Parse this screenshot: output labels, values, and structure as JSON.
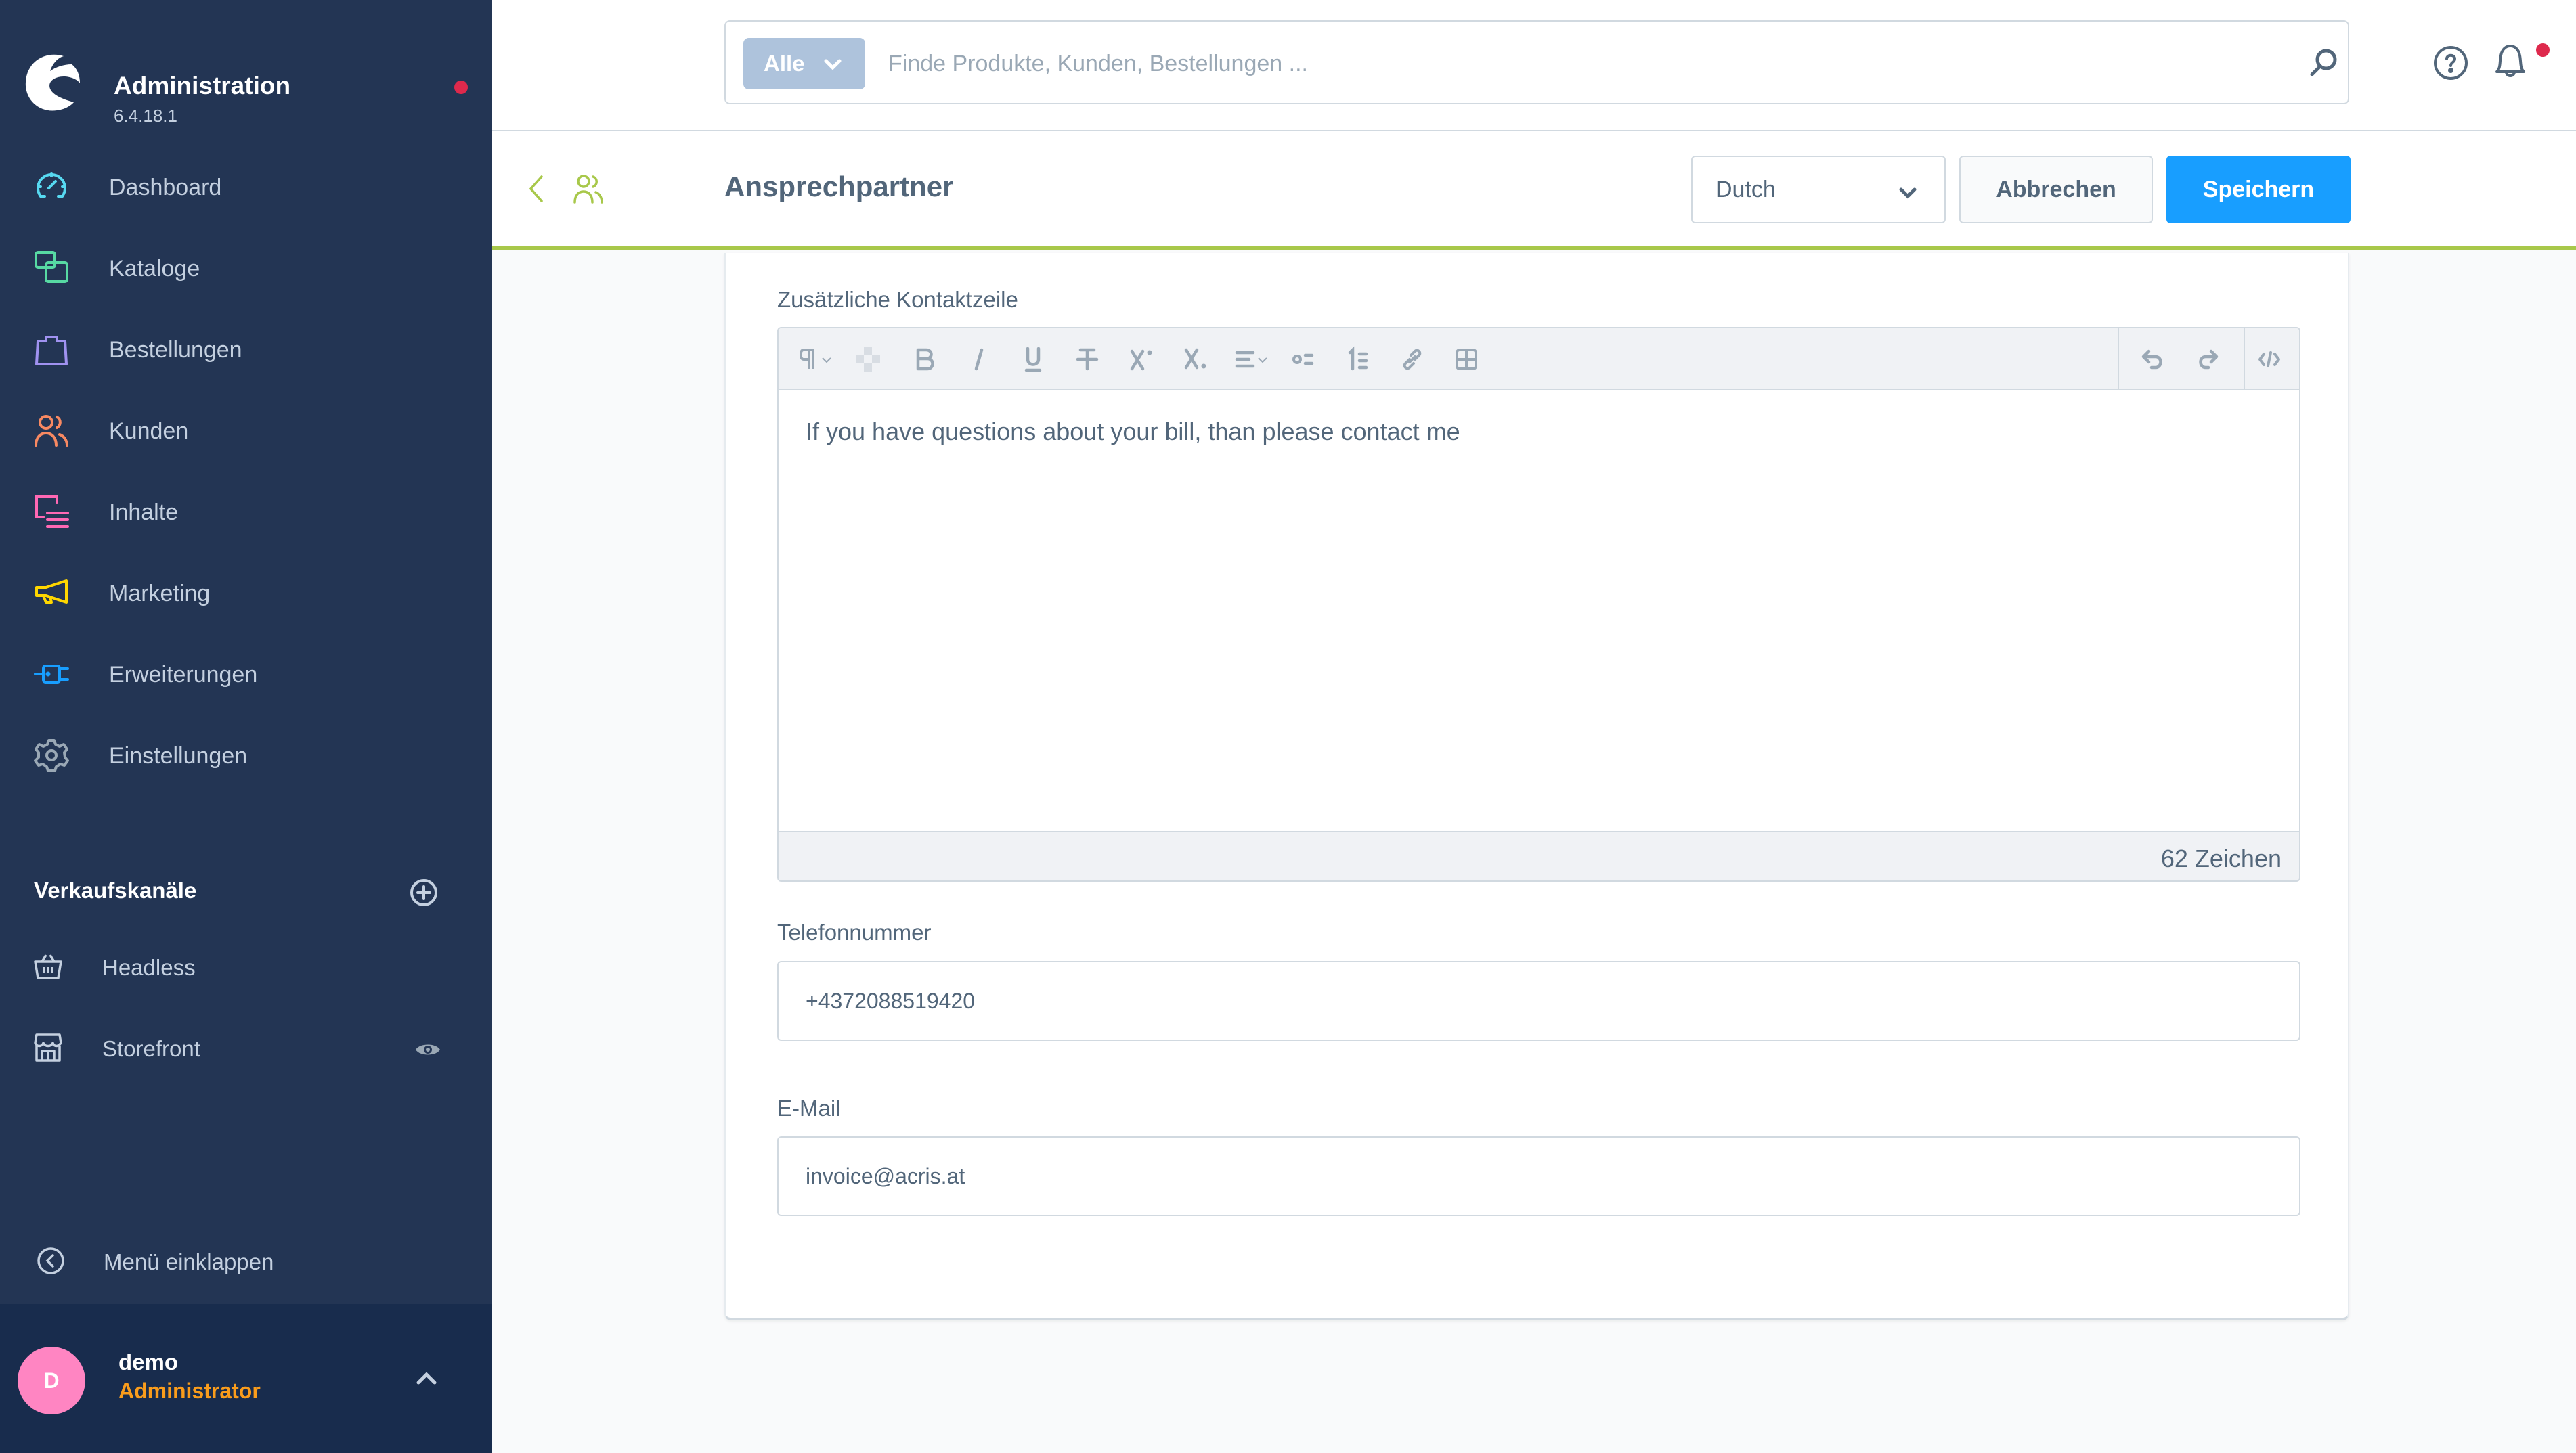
{
  "app": {
    "title": "Administration",
    "version": "6.4.18.1",
    "notification_dot_color": "#de294c"
  },
  "sidebar": {
    "items": [
      {
        "label": "Dashboard",
        "icon": "dashboard-icon",
        "color": "#57d9f1"
      },
      {
        "label": "Kataloge",
        "icon": "catalog-icon",
        "color": "#57d9a3"
      },
      {
        "label": "Bestellungen",
        "icon": "shopping-bag-icon",
        "color": "#a092f0"
      },
      {
        "label": "Kunden",
        "icon": "customers-icon",
        "color": "#f88962"
      },
      {
        "label": "Inhalte",
        "icon": "content-icon",
        "color": "#ff68b4"
      },
      {
        "label": "Marketing",
        "icon": "megaphone-icon",
        "color": "#ffd700"
      },
      {
        "label": "Erweiterungen",
        "icon": "plug-icon",
        "color": "#189eff"
      },
      {
        "label": "Einstellungen",
        "icon": "gear-icon",
        "color": "#9aa8b5"
      }
    ],
    "sales_channels": {
      "header": "Verkaufskanäle",
      "items": [
        {
          "label": "Headless",
          "icon": "basket-icon"
        },
        {
          "label": "Storefront",
          "icon": "storefront-icon"
        }
      ]
    },
    "collapse_label": "Menü einklappen",
    "user": {
      "initial": "D",
      "name": "demo",
      "role": "Administrator"
    }
  },
  "topbar": {
    "search_type": "Alle",
    "search_placeholder": "Finde Produkte, Kunden, Bestellungen ..."
  },
  "smartbar": {
    "title": "Ansprechpartner",
    "language": "Dutch",
    "cancel_label": "Abbrechen",
    "save_label": "Speichern",
    "accent_color": "#a8c84a"
  },
  "form": {
    "editor": {
      "label": "Zusätzliche Kontaktzeile",
      "content": "If you have questions about your bill, than please contact me",
      "char_count": "62 Zeichen",
      "toolbar": [
        "paragraph-format",
        "text-color",
        "bold",
        "italic",
        "underline",
        "strikethrough",
        "superscript",
        "subscript",
        "alignment",
        "unordered-list",
        "ordered-list",
        "link",
        "table",
        "undo",
        "redo",
        "code-view"
      ]
    },
    "phone": {
      "label": "Telefonnummer",
      "value": "+4372088519420"
    },
    "email": {
      "label": "E-Mail",
      "value": "invoice@acris.at"
    }
  }
}
